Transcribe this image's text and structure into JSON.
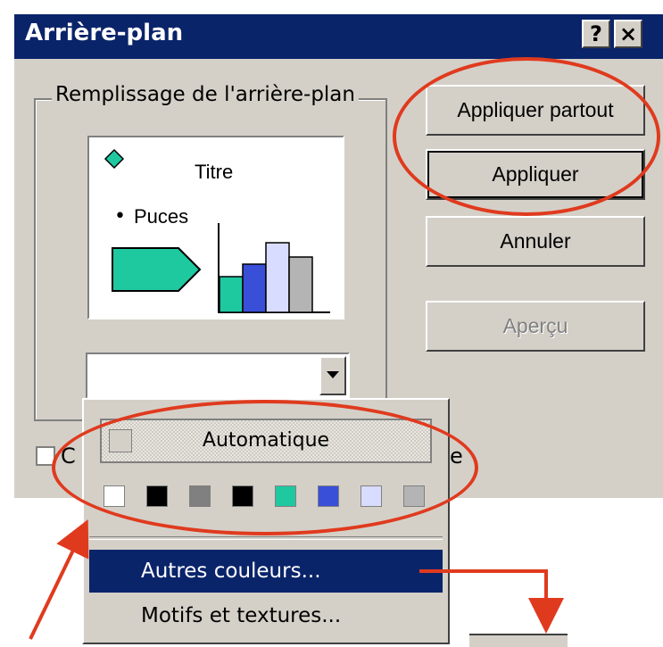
{
  "window": {
    "title": "Arrière-plan",
    "help_button": "?",
    "close_button": "×"
  },
  "group": {
    "label": "Remplissage de l'arrière-plan"
  },
  "preview": {
    "title": "Titre",
    "bullet": "•",
    "bullet_text": "Puces"
  },
  "buttons": {
    "apply_all": "Appliquer partout",
    "apply": "Appliquer",
    "cancel": "Annuler",
    "preview": "Aperçu"
  },
  "checkbox": {
    "label_left_fragment": "C",
    "label_right_fragment": "e"
  },
  "dropdown": {
    "auto_label": "Automatique",
    "swatches": [
      "#ffffff",
      "#000000",
      "#808080",
      "#000000",
      "#1fc9a0",
      "#3a4fd8",
      "#d8dcff",
      "#b4b4b4"
    ],
    "more_colors": "Autres couleurs...",
    "more_colors_underline": "o",
    "patterns": "Motifs et textures..."
  },
  "colors": {
    "annotation_red": "#e03a1e",
    "title_bar": "#0a246a",
    "accent_teal": "#1fc9a0",
    "bar_blue": "#3a4fd8"
  }
}
